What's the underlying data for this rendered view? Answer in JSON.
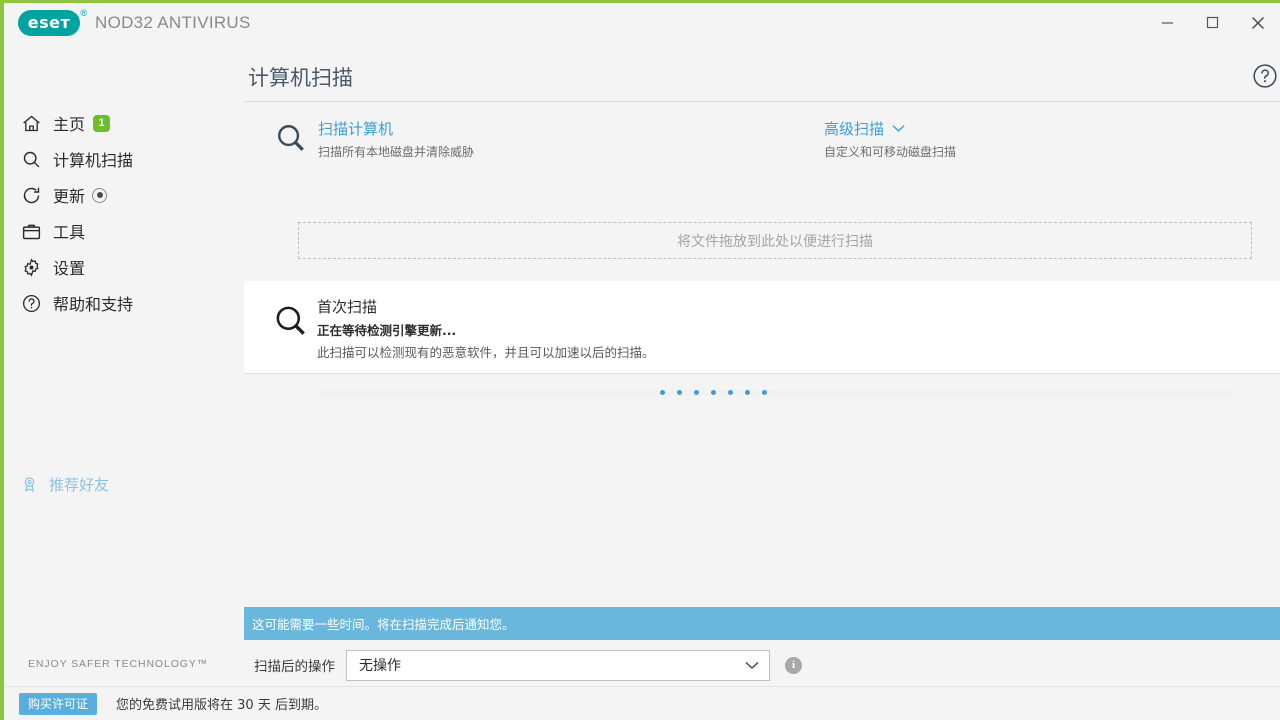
{
  "window": {
    "brand_mark": "eseт",
    "brand_reg": "®",
    "product_name": "NOD32 ANTIVIRUS",
    "controls": {
      "minimize": "minimize-icon",
      "maximize": "maximize-icon",
      "close": "close-icon"
    },
    "accent_green": "#8cc63e",
    "brand_teal": "#00a3a1"
  },
  "sidebar": {
    "items": [
      {
        "label": "主页",
        "icon": "home-icon",
        "badge": "1"
      },
      {
        "label": "计算机扫描",
        "icon": "search-icon",
        "badge": ""
      },
      {
        "label": "更新",
        "icon": "refresh-icon",
        "badge": ""
      },
      {
        "label": "工具",
        "icon": "toolbox-icon",
        "badge": ""
      },
      {
        "label": "设置",
        "icon": "gear-icon",
        "badge": ""
      },
      {
        "label": "帮助和支持",
        "icon": "question-circle-icon",
        "badge": ""
      }
    ],
    "refer": {
      "label": "推荐好友",
      "icon": "award-ribbon-icon"
    },
    "tagline": "ENJOY SAFER TECHNOLOGY™"
  },
  "main": {
    "title": "计算机扫描",
    "help_icon": "help-circle-icon",
    "scan_options": [
      {
        "title": "扫描计算机",
        "subtitle": "扫描所有本地磁盘并清除威胁",
        "icon": "magnifier-icon",
        "has_chevron": false
      },
      {
        "title": "高级扫描",
        "subtitle": "自定义和可移动磁盘扫描",
        "icon": "",
        "has_chevron": true
      }
    ],
    "dropzone_text": "将文件拖放到此处以便进行扫描",
    "scan_card": {
      "icon": "magnifier-icon",
      "name": "首次扫描",
      "status": "正在等待检测引擎更新...",
      "description": "此扫描可以检测现有的恶意软件，并且可以加速以后的扫描。",
      "progress_dots": 7
    },
    "info_bar": {
      "text": "这可能需要一些时间。将在扫描完成后通知您。",
      "color": "#6ab7de"
    },
    "action_after_scan": {
      "label": "扫描后的操作",
      "value": "无操作",
      "info_icon": "info-icon"
    }
  },
  "footer": {
    "buy_button": "购买许可证",
    "trial_text": "您的免费试用版将在 30 天 后到期。"
  }
}
